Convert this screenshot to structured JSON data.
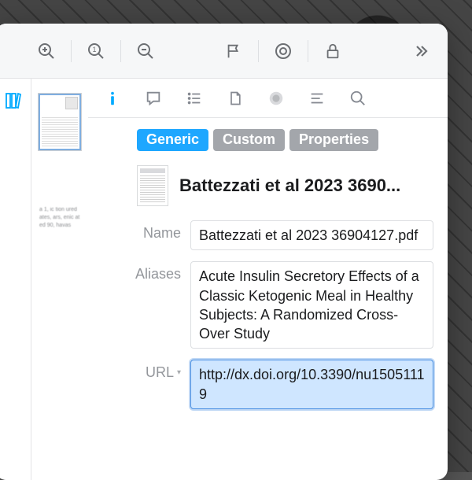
{
  "toolbar": {
    "icons": [
      "zoom-in",
      "zoom-actual",
      "zoom-out",
      "flag",
      "target",
      "lock",
      "more"
    ]
  },
  "inspector_tabs": {
    "icons": [
      "info",
      "comment",
      "list",
      "document",
      "circle-fill",
      "align",
      "search"
    ],
    "active_index": 0
  },
  "pills": {
    "generic": "Generic",
    "custom": "Custom",
    "properties": "Properties"
  },
  "document": {
    "title_truncated": "Battezzati et al 2023 3690..."
  },
  "fields": {
    "name": {
      "label": "Name",
      "value": "Battezzati et al 2023 36904127.pdf"
    },
    "aliases": {
      "label": "Aliases",
      "value": "Acute Insulin Secretory Effects of a Classic Ketogenic Meal in Healthy Subjects: A Randomized Cross-Over Study"
    },
    "url": {
      "label": "URL",
      "value": "http://dx.doi.org/10.3390/nu15051119"
    }
  },
  "blurred_left": "a 1,\n\nic\n\ntion ured ates, ars, enic ated 90, havas"
}
